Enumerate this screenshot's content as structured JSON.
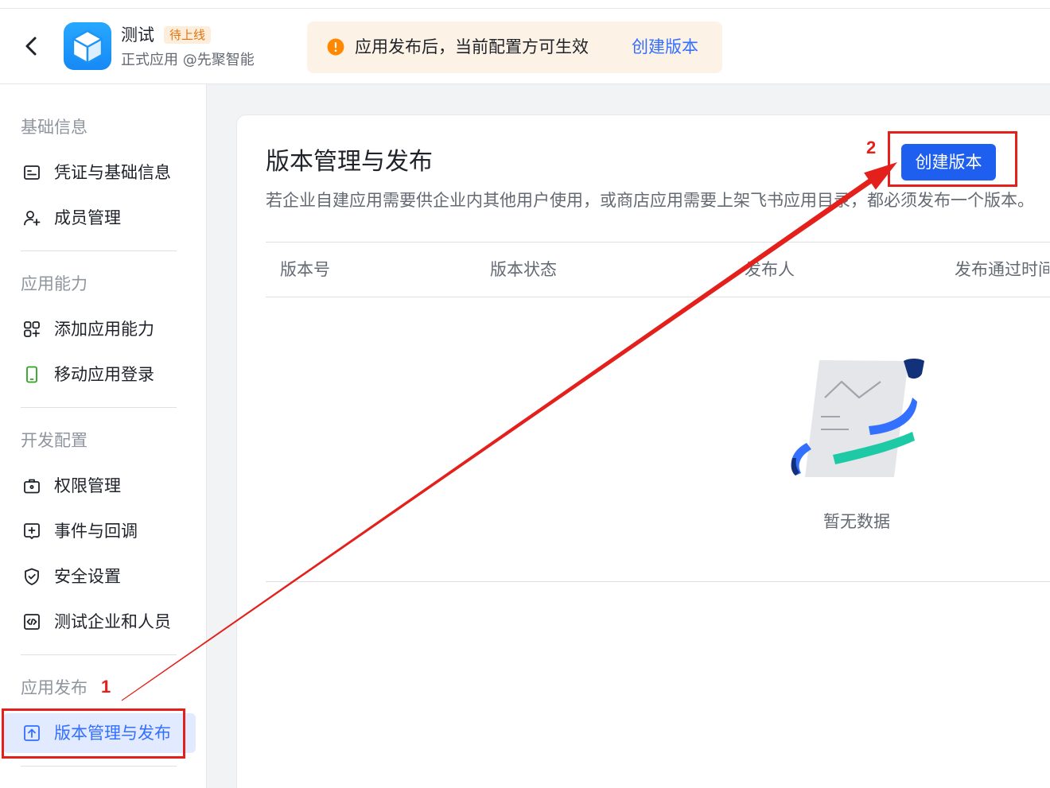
{
  "window": {
    "back_icon": "chevron-left-icon"
  },
  "app": {
    "icon": "cube-icon",
    "name": "测试",
    "status_badge": "待上线",
    "subtitle": "正式应用 @先聚智能"
  },
  "notice": {
    "icon": "warning-circle-icon",
    "text": "应用发布后，当前配置方可生效",
    "link_label": "创建版本"
  },
  "sidebar": {
    "sections": [
      {
        "title": "基础信息",
        "items": [
          {
            "label": "凭证与基础信息",
            "icon": "credential-icon"
          },
          {
            "label": "成员管理",
            "icon": "member-add-icon"
          }
        ]
      },
      {
        "title": "应用能力",
        "items": [
          {
            "label": "添加应用能力",
            "icon": "grid-add-icon"
          },
          {
            "label": "移动应用登录",
            "icon": "mobile-icon"
          }
        ]
      },
      {
        "title": "开发配置",
        "items": [
          {
            "label": "权限管理",
            "icon": "briefcase-icon"
          },
          {
            "label": "事件与回调",
            "icon": "event-callback-icon"
          },
          {
            "label": "安全设置",
            "icon": "shield-check-icon"
          },
          {
            "label": "测试企业和人员",
            "icon": "code-box-icon"
          }
        ]
      },
      {
        "title": "应用发布",
        "items": [
          {
            "label": "版本管理与发布",
            "icon": "upload-icon",
            "selected": true
          }
        ]
      }
    ]
  },
  "main": {
    "title": "版本管理与发布",
    "description": "若企业自建应用需要供企业内其他用户使用，或商店应用需要上架飞书应用目录，都必须发布一个版本。",
    "create_button_label": "创建版本",
    "table": {
      "columns": [
        "版本号",
        "版本状态",
        "发布人",
        "发布通过时间"
      ],
      "rows": [],
      "empty_icon": "empty-document-icon",
      "empty_text": "暂无数据"
    }
  },
  "annotations": {
    "step_1_label": "1",
    "step_2_label": "2",
    "arrow_icon": "red-arrow-icon"
  },
  "colors": {
    "primary": "#3370ff",
    "button": "#1f5ff0",
    "selected_bg": "#e1eaff",
    "warning": "#ff8800",
    "notice_bg": "#fdf2e6",
    "badge_text": "#e0740f",
    "badge_bg": "#fdeedc",
    "mobile_icon": "#2ea121",
    "annotation": "#e3201b",
    "text": "#1f2329",
    "text_secondary": "#646a73",
    "text_muted": "#8f959e"
  }
}
